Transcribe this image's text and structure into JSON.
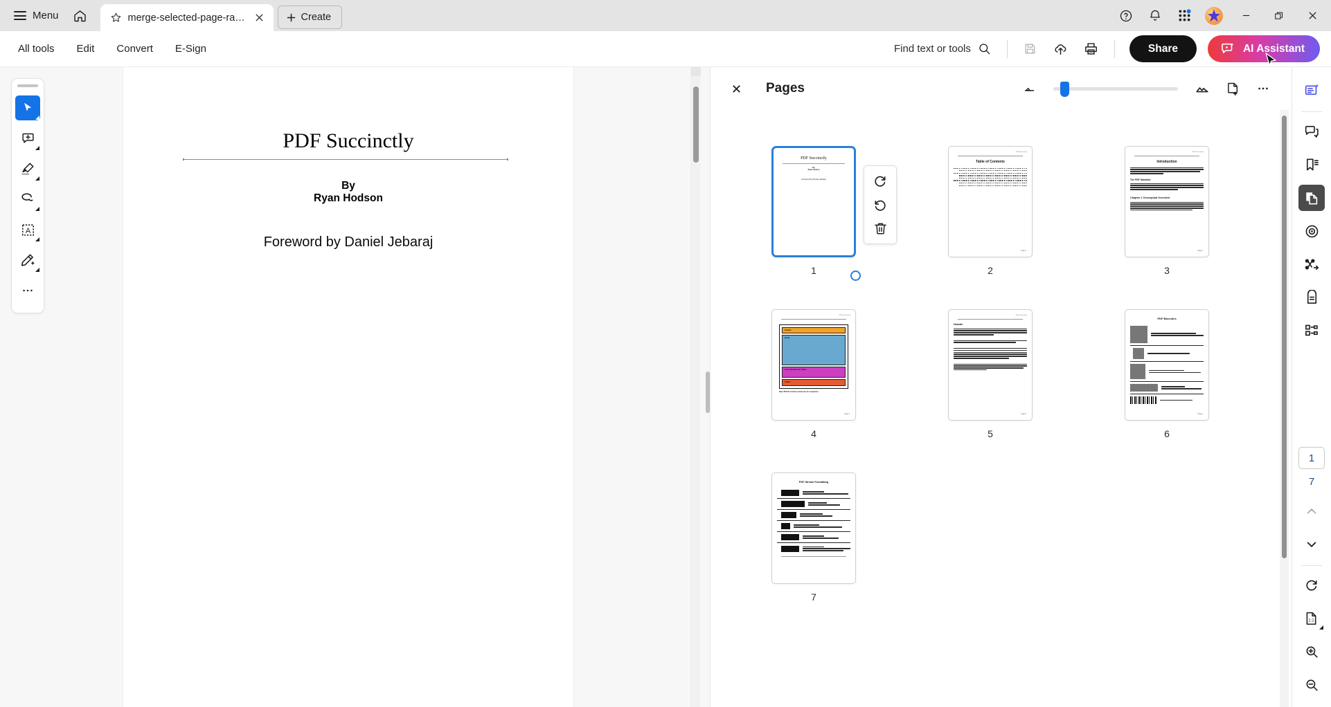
{
  "titlebar": {
    "menu_label": "Menu",
    "home_icon": "home-icon",
    "tab": {
      "title": "merge-selected-page-ran...",
      "star_icon": "star-icon",
      "close_icon": "close-icon"
    },
    "create_label": "Create",
    "icons": [
      "help-icon",
      "bell-icon",
      "apps-grid-icon"
    ],
    "avatar": "user-avatar",
    "window": [
      "minimize-button",
      "restore-button",
      "close-button"
    ]
  },
  "menubar": {
    "items": [
      {
        "label": "All tools"
      },
      {
        "label": "Edit"
      },
      {
        "label": "Convert"
      },
      {
        "label": "E-Sign"
      }
    ],
    "find_label": "Find text or tools",
    "icons": [
      "save-icon",
      "upload-cloud-icon",
      "print-icon"
    ],
    "share_label": "Share",
    "ai_label": "AI Assistant",
    "ai_gradient_from": "#ec3b3b",
    "ai_gradient_to": "#6f5bf0"
  },
  "quick_rail": {
    "tools": [
      {
        "name": "select-tool",
        "active": true
      },
      {
        "name": "add-comment-tool",
        "active": false
      },
      {
        "name": "highlight-tool",
        "active": false
      },
      {
        "name": "draw-freehand-tool",
        "active": false
      },
      {
        "name": "add-text-tool",
        "active": false
      },
      {
        "name": "sign-tool",
        "active": false
      },
      {
        "name": "more-tools",
        "active": false
      }
    ]
  },
  "document": {
    "title": "PDF Succinctly",
    "by_line_1": "By",
    "by_line_2": "Ryan Hodson",
    "foreword": "Foreword by Daniel Jebaraj"
  },
  "pages_panel": {
    "title": "Pages",
    "close_icon": "close-icon",
    "zoom_out_icon": "thumbnail-small-icon",
    "zoom_in_icon": "thumbnail-large-icon",
    "insert_page_icon": "insert-page-icon",
    "more_icon": "more-options-icon",
    "zoom_value": 8,
    "page_tools": [
      {
        "name": "rotate-clockwise-button",
        "icon": "rotate-cw-icon"
      },
      {
        "name": "rotate-counterclockwise-button",
        "icon": "rotate-ccw-icon"
      },
      {
        "name": "delete-page-button",
        "icon": "trash-icon"
      }
    ],
    "thumbnails": [
      {
        "label": "1",
        "selected": true,
        "kind": "cover",
        "header": "",
        "title": "PDF Succinctly",
        "by1": "By",
        "by2": "Ryan Hodson",
        "foreword": "Foreword by Daniel Jebaraj"
      },
      {
        "label": "2",
        "selected": false,
        "kind": "toc",
        "header": "PDF Succinctly",
        "title": "Table of Contents",
        "footer": "Page 2"
      },
      {
        "label": "3",
        "selected": false,
        "kind": "text2col",
        "header": "PDF Succinctly",
        "title": "Introduction",
        "sub1": "The PDF Standard",
        "sub2": "Chapter 1 Conceptual Overview",
        "footer": "Page 3"
      },
      {
        "label": "4",
        "selected": false,
        "kind": "diagram",
        "header": "PDF Succinctly",
        "segments": [
          "Header",
          "Body",
          "Cross-Reference Table",
          "Trailer"
        ],
        "segment_colors": [
          "#f0a22a",
          "#69a8cf",
          "#cc3fc0",
          "#e35b34"
        ],
        "caption": "Basic PDF file structure shown here for comparison",
        "footer": "Page 4"
      },
      {
        "label": "5",
        "selected": false,
        "kind": "prose",
        "header": "PDF Succinctly",
        "title": "Header",
        "footer": "Page 5"
      },
      {
        "label": "6",
        "selected": false,
        "kind": "barcodes",
        "header": "PDF Succinctly",
        "title": "PDF Barcodes",
        "rows": [
          "QR Barcode",
          "QR Barcode with Logo",
          "DataMatrix Barcode",
          "",
          "PDF417 Barcode"
        ],
        "footer": "Page 6"
      },
      {
        "label": "7",
        "selected": false,
        "kind": "list",
        "header": "PDF Succinctly",
        "title": "PDF Stream Formatting",
        "footer": "Page 7"
      }
    ]
  },
  "right_rail": {
    "top_tools": [
      {
        "name": "ai-assistant-panel-icon",
        "accent": "#5258e4",
        "active": false
      },
      {
        "name": "comments-icon",
        "active": false
      },
      {
        "name": "bookmarks-icon",
        "active": false
      },
      {
        "name": "page-thumbnails-icon",
        "active": true
      },
      {
        "name": "scan-target-icon",
        "active": false
      },
      {
        "name": "flow-diagram-icon",
        "active": false
      },
      {
        "name": "tags-icon",
        "active": false
      },
      {
        "name": "content-tree-icon",
        "active": false
      }
    ],
    "current_page": "1",
    "page_count": "7",
    "nav": [
      {
        "name": "previous-page-button",
        "icon": "chevron-up-icon"
      },
      {
        "name": "next-page-button",
        "icon": "chevron-down-icon"
      }
    ],
    "bottom_tools": [
      {
        "name": "rotate-view-button",
        "icon": "rotate-cw-icon"
      },
      {
        "name": "fit-page-button",
        "icon": "fit-1-to-1-icon"
      },
      {
        "name": "zoom-in-button",
        "icon": "zoom-in-icon"
      },
      {
        "name": "zoom-out-button",
        "icon": "zoom-out-icon"
      }
    ]
  }
}
